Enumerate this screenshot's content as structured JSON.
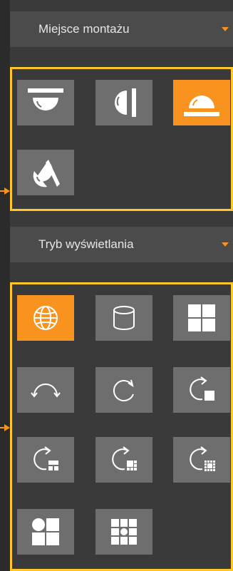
{
  "mount": {
    "title": "Miejsce montażu",
    "buttons": [
      {
        "id": "ceiling-mount",
        "icon": "ceiling-dome-icon",
        "active": false
      },
      {
        "id": "wall-mount",
        "icon": "wall-dome-icon",
        "active": false
      },
      {
        "id": "floor-mount",
        "icon": "floor-dome-icon",
        "active": true
      },
      {
        "id": "tilted-mount",
        "icon": "tilted-dome-icon",
        "active": false
      }
    ]
  },
  "display": {
    "title": "Tryb wyświetlania",
    "buttons": [
      {
        "id": "fisheye",
        "icon": "globe-icon",
        "active": true
      },
      {
        "id": "panorama-cylinder",
        "icon": "cylinder-icon",
        "active": false
      },
      {
        "id": "quad-view",
        "icon": "quad-grid-icon",
        "active": false
      },
      {
        "id": "180-panorama",
        "icon": "half-arc-arrows-icon",
        "active": false
      },
      {
        "id": "360-panorama",
        "icon": "circular-arrow-icon",
        "active": false
      },
      {
        "id": "360-plus-1",
        "icon": "circular-arrow-single-icon",
        "active": false
      },
      {
        "id": "360-plus-3",
        "icon": "circular-arrow-three-icon",
        "active": false
      },
      {
        "id": "360-plus-6",
        "icon": "circular-arrow-six-icon",
        "active": false
      },
      {
        "id": "360-plus-8",
        "icon": "circular-arrow-eight-icon",
        "active": false
      },
      {
        "id": "fisheye-plus-3",
        "icon": "quad-mixed-icon",
        "active": false
      },
      {
        "id": "fisheye-plus-8",
        "icon": "nine-grid-icon",
        "active": false
      }
    ]
  },
  "colors": {
    "accent": "#f7931e",
    "highlight_border": "#ffc72c",
    "button": "#6e6e6e",
    "header": "#4b4b4b",
    "panel": "#3a3a3a"
  }
}
